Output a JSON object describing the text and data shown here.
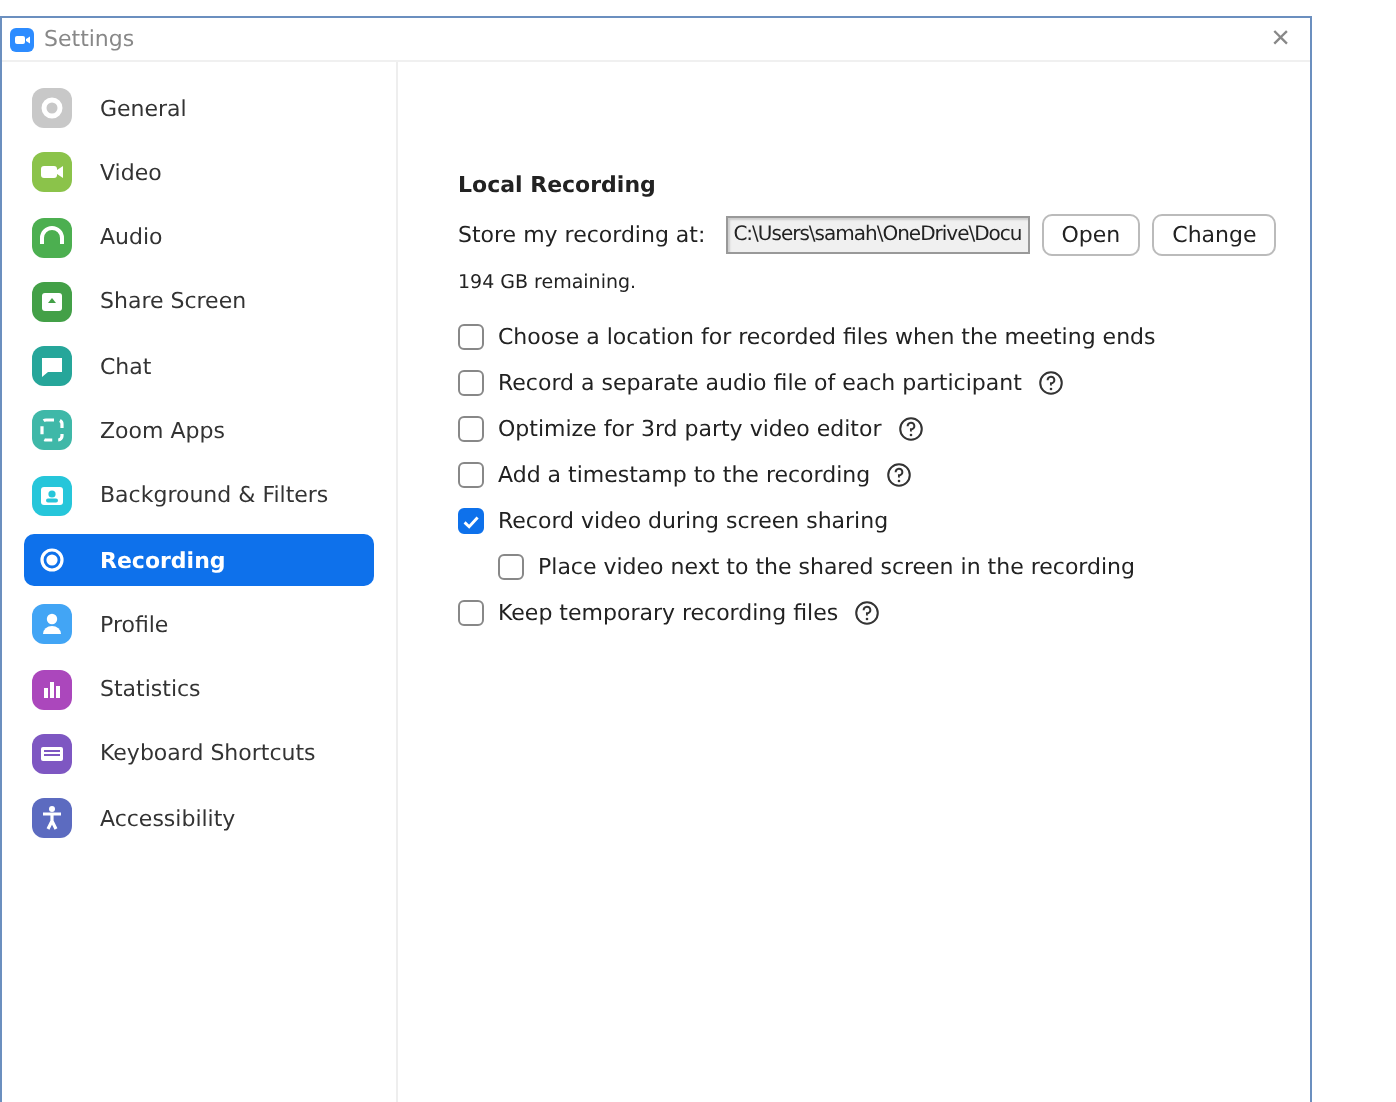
{
  "window": {
    "title": "Settings",
    "close": "×"
  },
  "sidebar": {
    "items": [
      {
        "label": "General",
        "color": "#c8c8c8",
        "selected": false
      },
      {
        "label": "Video",
        "color": "#8bc34a",
        "selected": false
      },
      {
        "label": "Audio",
        "color": "#4caf50",
        "selected": false
      },
      {
        "label": "Share Screen",
        "color": "#43a047",
        "selected": false
      },
      {
        "label": "Chat",
        "color": "#26a69a",
        "selected": false
      },
      {
        "label": "Zoom Apps",
        "color": "#3fb8a8",
        "selected": false
      },
      {
        "label": "Background & Filters",
        "color": "#26c6da",
        "selected": false
      },
      {
        "label": "Recording",
        "color": "#ffffff",
        "selected": true
      },
      {
        "label": "Profile",
        "color": "#42a5f5",
        "selected": false
      },
      {
        "label": "Statistics",
        "color": "#ab47bc",
        "selected": false
      },
      {
        "label": "Keyboard Shortcuts",
        "color": "#7e57c2",
        "selected": false
      },
      {
        "label": "Accessibility",
        "color": "#5c6bc0",
        "selected": false
      }
    ]
  },
  "section": {
    "title": "Local Recording",
    "location": {
      "label": "Store my recording at:",
      "value": "C:\\Users\\samah\\OneDrive\\Docu",
      "buttons": [
        "Open",
        "Change"
      ]
    },
    "remaining": "194 GB remaining.",
    "options": [
      {
        "label": "Choose a location for recorded files when the meeting ends",
        "checked": false,
        "help": false
      },
      {
        "label": "Record a separate audio file of each participant",
        "checked": false,
        "help": true
      },
      {
        "label": "Optimize for 3rd party video editor",
        "checked": false,
        "help": true
      },
      {
        "label": "Add a timestamp to the recording",
        "checked": false,
        "help": true
      },
      {
        "label": "Record video during screen sharing",
        "checked": true,
        "help": false,
        "children": [
          {
            "label": "Place video next to the shared screen in the recording",
            "checked": false,
            "help": false
          }
        ]
      },
      {
        "label": "Keep temporary recording files",
        "checked": false,
        "help": true
      }
    ]
  }
}
